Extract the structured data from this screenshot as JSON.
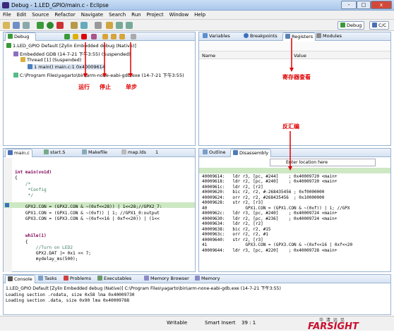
{
  "window": {
    "title": "Debug - 1.LED_GPIO/main.c - Eclipse",
    "min": "-",
    "max": "□",
    "close": "x"
  },
  "menu": [
    "File",
    "Edit",
    "Source",
    "Refactor",
    "Navigate",
    "Search",
    "Run",
    "Project",
    "Window",
    "Help"
  ],
  "perspectives": {
    "debug": "Debug",
    "cc": "C/C"
  },
  "debug_view": {
    "tab": "Debug",
    "tree": [
      "1.LED_GPIO Default [Zylin Embedded debug (Native)]",
      "Embedded GDB (14-7-21 下午3:55) (Suspended)",
      "Thread [1] (Suspended)",
      "1 main() main.c:1 0x40009614",
      "C:\\Program Files\\yagarto\\bin\\arm-none-eabi-gdb.exe (14-7-21 下午3:55)"
    ]
  },
  "annotations": {
    "run": "运行",
    "stop": "停止",
    "step": "单步",
    "registers": "寄存器查看",
    "disasm": "反汇编"
  },
  "var_view": {
    "tabs": [
      "Variables",
      "Breakpoints",
      "Registers",
      "Modules"
    ],
    "columns": [
      "Name",
      "Value"
    ]
  },
  "editor": {
    "tabs": [
      "main.c",
      "start.S",
      "Makefile",
      "map.lds",
      "1"
    ],
    "lines": [
      "int main(void)",
      "{",
      "    /*",
      "     *Config",
      "     */",
      "",
      "    GPX2.CON = (GPX2.CON & ~(0xf<<28)) | 1<<28;//GPX2_7:",
      "    GPX1.CON = (GPX1.CON & ~(0xf)) | 1; //GPX1_0:output",
      "    GPX3.CON = (GPX3.CON & ~(0xf<<16 | 0xf<<20)) | (1<<",
      "",
      "",
      "    while(1)",
      "    {",
      "        //Turn on LED2",
      "        GPX2.DAT |= 0x1 << 7;",
      "        mydelay_ms(500);"
    ]
  },
  "disasm_view": {
    "tabs": [
      "Outline",
      "Disassembly"
    ],
    "location_placeholder": "Enter location here",
    "lines": [
      "40009614:   ldr r3, [pc, #244]    ; 0x40009720 <main+",
      "40009618:   ldr r2, [pc, #240]    ; 0x40009720 <main+",
      "4000961c:   ldr r2, [r2]",
      "40009620:   bic r2, r2, #-268435456 ; 0xf0000000",
      "40009624:   orr r2, r2, #268435456  ; 0x10000000",
      "40009628:   str r2, [r3]",
      "40               GPX1.CON = (GPX1.CON & ~(0xf)) | 1; //GPX",
      "4000962c:   ldr r3, [pc, #240]    ; 0x40009724 <main+",
      "40009630:   ldr r2, [pc, #236]    ; 0x40009724 <main+",
      "40009634:   ldr r2, [r2]",
      "40009638:   bic r2, r2, #15",
      "4000963c:   orr r2, r2, #1",
      "40009640:   str r2, [r3]",
      "41               GPX3.CON = (GPX3.CON & ~(0xf<<16 | 0xf<<20",
      "40009644:   ldr r3, [pc, #220]    ; 0x40009728 <main+"
    ]
  },
  "console": {
    "tabs": [
      "Console",
      "Tasks",
      "Problems",
      "Executables",
      "Memory Browser",
      "Memory"
    ],
    "header": "1.LED_GPIO Default [Zylin Embedded debug (Native)] C:\\Program Files\\yagarto\\bin\\arm-none-eabi-gdb.exe (14-7-21 下午3:55)",
    "lines": [
      "Loading section .rodata, size 0x58 lma 0x40009730",
      "Loading section .data, size 0x90 lma 0x40009788"
    ]
  },
  "status": {
    "writable": "Writable",
    "insert": "Smart Insert",
    "pos": "39 : 1"
  },
  "logo": {
    "cn": "华 清 远 见",
    "en": "FARSIGHT"
  }
}
